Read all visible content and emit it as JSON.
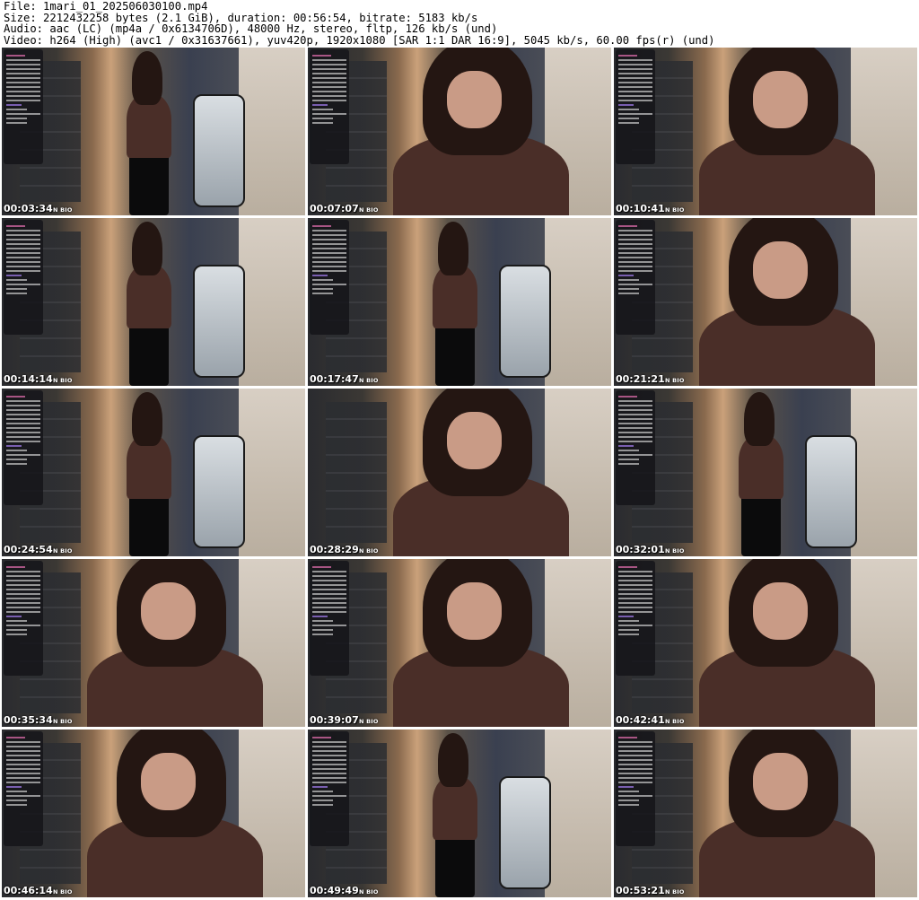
{
  "header": {
    "file_line": "File: 1mari_01_202506030100.mp4",
    "size_line": "Size: 2212432258 bytes (2.1 GiB), duration: 00:56:54, bitrate: 5183 kb/s",
    "audio_line": "Audio: aac (LC) (mp4a / 0x6134706D), 48000 Hz, stereo, fltp, 126 kb/s (und)",
    "video_line": "Video: h264 (High) (avc1 / 0x31637661), yuv420p, 1920x1080 [SAR 1:1 DAR 16:9], 5045 kb/s, 60.00 fps(r) (und)"
  },
  "thumbnails": [
    {
      "timestamp": "00:03:34",
      "bio": "N BIO"
    },
    {
      "timestamp": "00:07:07",
      "bio": "N BIO"
    },
    {
      "timestamp": "00:10:41",
      "bio": "N BIO"
    },
    {
      "timestamp": "00:14:14",
      "bio": "N BIO"
    },
    {
      "timestamp": "00:17:47",
      "bio": "N BIO"
    },
    {
      "timestamp": "00:21:21",
      "bio": "N BIO"
    },
    {
      "timestamp": "00:24:54",
      "bio": "N BIO"
    },
    {
      "timestamp": "00:28:29",
      "bio": "N BIO"
    },
    {
      "timestamp": "00:32:01",
      "bio": "N BIO"
    },
    {
      "timestamp": "00:35:34",
      "bio": "N BIO"
    },
    {
      "timestamp": "00:39:07",
      "bio": "N BIO"
    },
    {
      "timestamp": "00:42:41",
      "bio": "N BIO"
    },
    {
      "timestamp": "00:46:14",
      "bio": "N BIO"
    },
    {
      "timestamp": "00:49:49",
      "bio": "N BIO"
    },
    {
      "timestamp": "00:53:21",
      "bio": "N BIO"
    }
  ],
  "colors": {
    "background": "#ffffff",
    "timestamp_text": "#ffffff",
    "overlay_panel": "#141418"
  }
}
